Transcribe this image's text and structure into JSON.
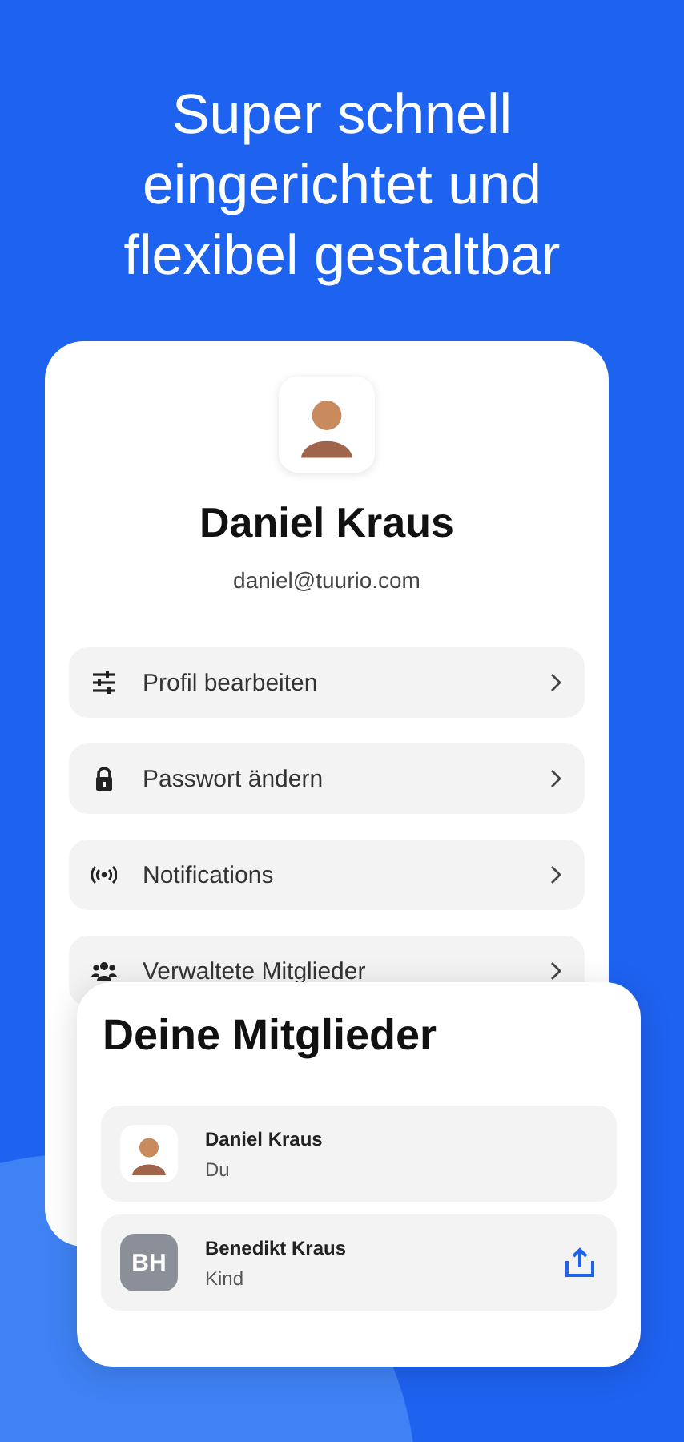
{
  "headline": [
    "Super schnell",
    "eingerichtet und",
    "flexibel gestaltbar"
  ],
  "profile": {
    "name": "Daniel Kraus",
    "email": "daniel@tuurio.com"
  },
  "menu": [
    {
      "kind": "sliders",
      "label": "Profil bearbeiten"
    },
    {
      "kind": "lock",
      "label": "Passwort ändern"
    },
    {
      "kind": "broadcast",
      "label": "Notifications"
    },
    {
      "kind": "group",
      "label": "Verwaltete Mitglieder"
    }
  ],
  "members_card": {
    "title": "Deine Mitglieder",
    "members": [
      {
        "kind": "avatar",
        "name": "Daniel Kraus",
        "role": "Du",
        "share_button": false
      },
      {
        "kind": "initials",
        "initials": "BH",
        "name": "Benedikt Kraus",
        "role": "Kind",
        "share_button": true
      }
    ]
  }
}
